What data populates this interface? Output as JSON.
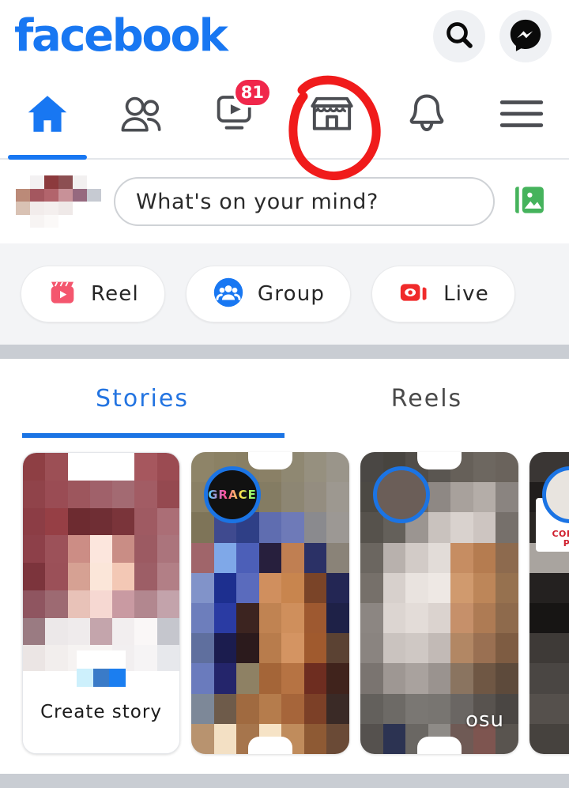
{
  "app": {
    "brand": "facebook",
    "brand_color": "#1877F2"
  },
  "header": {
    "search_icon": "search-icon",
    "messenger_icon": "messenger-icon"
  },
  "nav": {
    "items": [
      {
        "key": "home",
        "icon": "home-icon",
        "active": true,
        "badge": ""
      },
      {
        "key": "friends",
        "icon": "friends-icon",
        "active": false,
        "badge": ""
      },
      {
        "key": "video",
        "icon": "video-icon",
        "active": false,
        "badge": "81"
      },
      {
        "key": "marketplace",
        "icon": "marketplace-store-icon",
        "active": false,
        "badge": ""
      },
      {
        "key": "notifications",
        "icon": "bell-icon",
        "active": false,
        "badge": ""
      },
      {
        "key": "menu",
        "icon": "hamburger-menu-icon",
        "active": false,
        "badge": ""
      }
    ]
  },
  "annotation": {
    "type": "hand-drawn-circle",
    "color": "#F01B1B",
    "target": "marketplace"
  },
  "composer": {
    "placeholder": "What's on your mind?",
    "photo_icon": "photo-gallery-icon",
    "photo_icon_color": "#45B35C",
    "avatar": "user-avatar"
  },
  "chips": [
    {
      "label": "Reel",
      "icon": "reel-clapperboard-icon",
      "color": "#F4566E"
    },
    {
      "label": "Group",
      "icon": "group-people-icon",
      "color": "#1877F2"
    },
    {
      "label": "Live",
      "icon": "live-video-icon",
      "color": "#F02B2B"
    }
  ],
  "media_tabs": [
    {
      "label": "Stories",
      "active": true
    },
    {
      "label": "Reels",
      "active": false
    }
  ],
  "stories": [
    {
      "type": "create",
      "label": "Create story",
      "caption": "",
      "ring_text": ""
    },
    {
      "type": "story",
      "label": "",
      "caption": "",
      "ring_text": "GRACE"
    },
    {
      "type": "story",
      "label": "",
      "caption": "osu",
      "ring_text": ""
    },
    {
      "type": "story",
      "label": "",
      "caption": "",
      "ring_text": "",
      "print_line1": "CORD",
      "print_line2": "P"
    }
  ]
}
